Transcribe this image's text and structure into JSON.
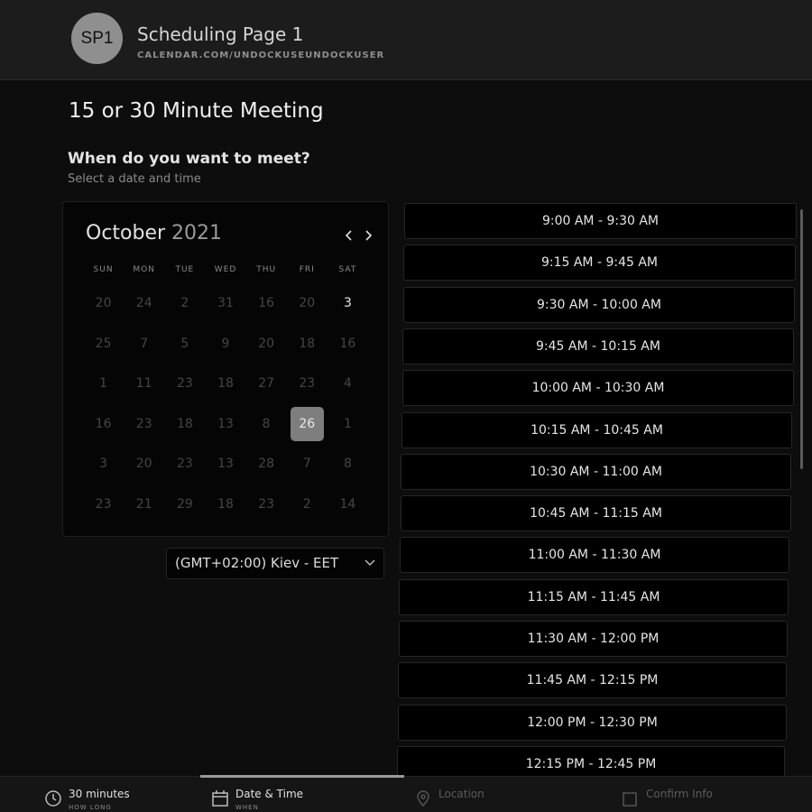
{
  "header": {
    "avatar_initials": "SP1",
    "page_name": "Scheduling Page 1",
    "url": "CALENDAR.COM/UNDOCKUSEUNDOCKUSER"
  },
  "meeting": {
    "title": "15 or 30 Minute Meeting",
    "question": "When do you want to meet?",
    "instruction": "Select a date and time"
  },
  "calendar": {
    "month": "October",
    "year": "2021",
    "weekdays": [
      "SUN",
      "MON",
      "TUE",
      "WED",
      "THU",
      "FRI",
      "SAT"
    ],
    "days": [
      [
        "20",
        "24",
        "2",
        "31",
        "16",
        "20",
        "3"
      ],
      [
        "25",
        "7",
        "5",
        "9",
        "20",
        "18",
        "16"
      ],
      [
        "1",
        "11",
        "23",
        "18",
        "27",
        "23",
        "4"
      ],
      [
        "16",
        "23",
        "18",
        "13",
        "8",
        "26",
        "1"
      ],
      [
        "3",
        "20",
        "23",
        "13",
        "28",
        "7",
        "8"
      ],
      [
        "23",
        "21",
        "29",
        "18",
        "23",
        "2",
        "14"
      ]
    ],
    "selected_day": "26",
    "prev_icon": "chevron-left-icon",
    "next_icon": "chevron-right-icon"
  },
  "timezone": {
    "label": "(GMT+02:00) Kiev - EET",
    "icon": "chevron-down-icon"
  },
  "time_slots": [
    "9:00 AM - 9:30 AM",
    "9:15 AM - 9:45 AM",
    "9:30 AM - 10:00 AM",
    "9:45 AM - 10:15 AM",
    "10:00 AM - 10:30 AM",
    "10:15 AM - 10:45 AM",
    "10:30 AM - 11:00 AM",
    "10:45 AM - 11:15 AM",
    "11:00 AM - 11:30 AM",
    "11:15 AM - 11:45 AM",
    "11:30 AM - 12:00 PM",
    "11:45 AM - 12:15 PM",
    "12:00 PM - 12:30 PM",
    "12:15 PM - 12:45 PM"
  ],
  "steps": [
    {
      "title": "30 minutes",
      "subtitle": "HOW LONG",
      "icon": "clock-icon"
    },
    {
      "title": "Date & Time",
      "subtitle": "WHEN",
      "icon": "calendar-icon"
    },
    {
      "title": "Location",
      "subtitle": "",
      "icon": "location-pin-icon"
    },
    {
      "title": "Confirm Info",
      "subtitle": "",
      "icon": "checkbox-icon"
    }
  ],
  "colors": {
    "background": "#0d0d0d",
    "header": "#1c1c1c",
    "selected_day": "#7e7e7e",
    "avatar": "#8f8f8f"
  }
}
